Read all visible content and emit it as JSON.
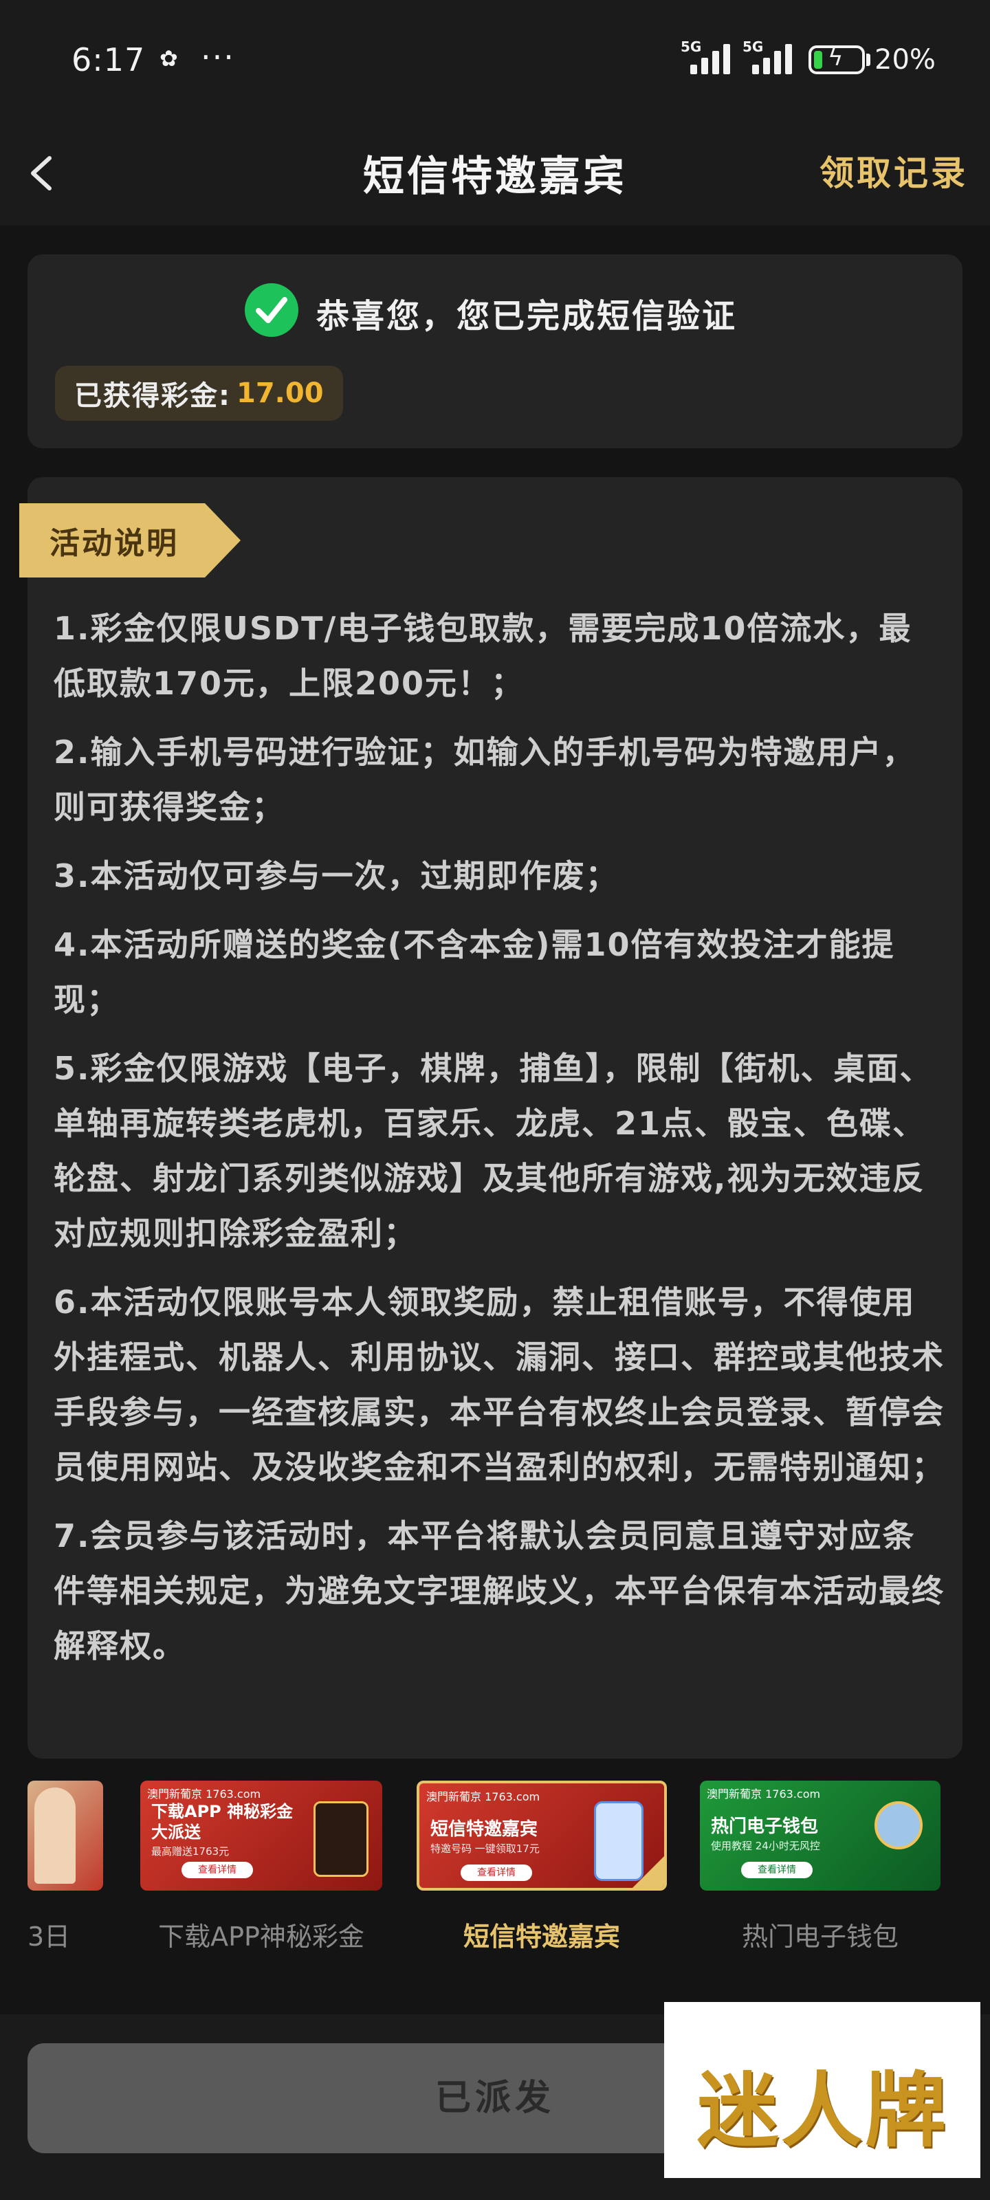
{
  "status_bar": {
    "time": "6:17",
    "dots": "···",
    "sim1": "5G",
    "sim2": "5G",
    "battery_percent": "20%",
    "battery_level": 0.2
  },
  "nav": {
    "title": "短信特邀嘉宾",
    "record_link": "领取记录"
  },
  "success": {
    "message": "恭喜您，您已完成短信验证",
    "bonus_label": "已获得彩金:",
    "bonus_value": "17.00"
  },
  "rules": {
    "title": "活动说明",
    "items": [
      "1.彩金仅限USDT/电子钱包取款，需要完成10倍流水，最低取款170元，上限200元！；",
      "2.输入手机号码进行验证；如输入的手机号码为特邀用户，则可获得奖金；",
      "3.本活动仅可参与一次，过期即作废；",
      "4.本活动所赠送的奖金(不含本金)需10倍有效投注才能提现；",
      "5.彩金仅限游戏【电子，棋牌，捕鱼】，限制【街机、桌面、单轴再旋转类老虎机，百家乐、龙虎、21点、骰宝、色碟、轮盘、射龙门系列类似游戏】及其他所有游戏,视为无效违反对应规则扣除彩金盈利；",
      "6.本活动仅限账号本人领取奖励，禁止租借账号，不得使用外挂程式、机器人、利用协议、漏洞、接口、群控或其他技术手段参与，一经查核属实，本平台有权终止会员登录、暂停会员使用网站、及没收奖金和不当盈利的权利，无需特别通知；",
      "7.会员参与该活动时，本平台将默认会员同意且遵守对应条件等相关规定，为避免文字理解歧义，本平台保有本活动最终解释权。"
    ]
  },
  "promos": [
    {
      "caption": "3日",
      "big": "",
      "sub": "",
      "btn": "",
      "head": ""
    },
    {
      "caption": "下载APP神秘彩金",
      "head": "澳門新葡京 1763.com",
      "big": "下载APP 神秘彩金大派送",
      "sub": "最高赠送1763元",
      "btn": "查看详情"
    },
    {
      "caption": "短信特邀嘉宾",
      "head": "澳門新葡京 1763.com",
      "big": "短信特邀嘉宾",
      "sub": "特邀号码 一键领取17元",
      "btn": "查看详情"
    },
    {
      "caption": "热门电子钱包",
      "head": "澳門新葡京 1763.com",
      "big": "热门电子钱包",
      "sub": "使用教程 24小时无风控",
      "btn": "查看详情"
    }
  ],
  "bottom": {
    "button_label": "已派发"
  },
  "watermark": {
    "text": "迷人牌"
  },
  "colors": {
    "accent_gold": "#e7c36b",
    "success_green": "#1ec25a",
    "bonus_orange": "#f2b531"
  }
}
